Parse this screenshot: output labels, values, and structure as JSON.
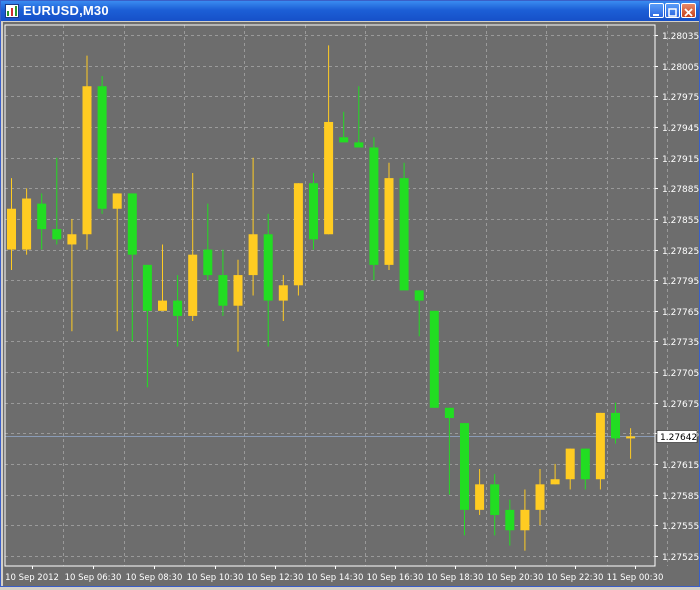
{
  "window": {
    "title": "EURUSD,M30"
  },
  "colors": {
    "background": "#6d6d6d",
    "grid": "#9a9a9a",
    "axis": "#ffffff",
    "bull": "#ffcc22",
    "bear": "#22dd22",
    "price_line": "#8a9bb5"
  },
  "chart_data": {
    "type": "candlestick",
    "title": "EURUSD,M30",
    "ylim": [
      1.2751,
      1.2805
    ],
    "y_ticks": [
      "1.28035",
      "1.28005",
      "1.27975",
      "1.27945",
      "1.27915",
      "1.27885",
      "1.27855",
      "1.27825",
      "1.27795",
      "1.27765",
      "1.27735",
      "1.27705",
      "1.27675",
      "1.27645",
      "1.27615",
      "1.27585",
      "1.27555",
      "1.27525"
    ],
    "x_ticks": [
      "10 Sep 2012",
      "10 Sep 06:30",
      "10 Sep 08:30",
      "10 Sep 10:30",
      "10 Sep 12:30",
      "10 Sep 14:30",
      "10 Sep 16:30",
      "10 Sep 18:30",
      "10 Sep 20:30",
      "10 Sep 22:30",
      "11 Sep 00:30"
    ],
    "current_price": "1.27642",
    "grid": true,
    "candles": [
      {
        "o": 1.27825,
        "h": 1.27895,
        "l": 1.27805,
        "c": 1.27865
      },
      {
        "o": 1.27825,
        "h": 1.27885,
        "l": 1.2782,
        "c": 1.27875
      },
      {
        "o": 1.2787,
        "h": 1.2788,
        "l": 1.27825,
        "c": 1.27845
      },
      {
        "o": 1.27845,
        "h": 1.27915,
        "l": 1.2783,
        "c": 1.27835
      },
      {
        "o": 1.2783,
        "h": 1.27855,
        "l": 1.27745,
        "c": 1.2784
      },
      {
        "o": 1.2784,
        "h": 1.28015,
        "l": 1.27825,
        "c": 1.27985
      },
      {
        "o": 1.27985,
        "h": 1.27995,
        "l": 1.2786,
        "c": 1.27865
      },
      {
        "o": 1.27865,
        "h": 1.2788,
        "l": 1.27745,
        "c": 1.2788
      },
      {
        "o": 1.2788,
        "h": 1.2788,
        "l": 1.27735,
        "c": 1.2782
      },
      {
        "o": 1.2781,
        "h": 1.2781,
        "l": 1.2769,
        "c": 1.27765
      },
      {
        "o": 1.27765,
        "h": 1.2783,
        "l": 1.27765,
        "c": 1.27775
      },
      {
        "o": 1.27775,
        "h": 1.278,
        "l": 1.2773,
        "c": 1.2776
      },
      {
        "o": 1.2776,
        "h": 1.279,
        "l": 1.27755,
        "c": 1.2782
      },
      {
        "o": 1.27825,
        "h": 1.2787,
        "l": 1.27795,
        "c": 1.278
      },
      {
        "o": 1.278,
        "h": 1.27825,
        "l": 1.2776,
        "c": 1.2777
      },
      {
        "o": 1.2777,
        "h": 1.27815,
        "l": 1.27725,
        "c": 1.278
      },
      {
        "o": 1.278,
        "h": 1.27915,
        "l": 1.2778,
        "c": 1.2784
      },
      {
        "o": 1.2784,
        "h": 1.2786,
        "l": 1.2773,
        "c": 1.27775
      },
      {
        "o": 1.27775,
        "h": 1.278,
        "l": 1.27755,
        "c": 1.2779
      },
      {
        "o": 1.2779,
        "h": 1.2789,
        "l": 1.2778,
        "c": 1.2789
      },
      {
        "o": 1.2789,
        "h": 1.279,
        "l": 1.27825,
        "c": 1.27835
      },
      {
        "o": 1.2784,
        "h": 1.28025,
        "l": 1.2784,
        "c": 1.2795
      },
      {
        "o": 1.27935,
        "h": 1.2796,
        "l": 1.2793,
        "c": 1.2793
      },
      {
        "o": 1.2793,
        "h": 1.27985,
        "l": 1.27925,
        "c": 1.27925
      },
      {
        "o": 1.27925,
        "h": 1.27935,
        "l": 1.27795,
        "c": 1.2781
      },
      {
        "o": 1.2781,
        "h": 1.2791,
        "l": 1.27805,
        "c": 1.27895
      },
      {
        "o": 1.27895,
        "h": 1.2791,
        "l": 1.2779,
        "c": 1.27785
      },
      {
        "o": 1.27785,
        "h": 1.27785,
        "l": 1.2774,
        "c": 1.27775
      },
      {
        "o": 1.27765,
        "h": 1.27765,
        "l": 1.2767,
        "c": 1.2767
      },
      {
        "o": 1.2767,
        "h": 1.2767,
        "l": 1.27585,
        "c": 1.2766
      },
      {
        "o": 1.27655,
        "h": 1.27655,
        "l": 1.27545,
        "c": 1.2757
      },
      {
        "o": 1.2757,
        "h": 1.2761,
        "l": 1.27565,
        "c": 1.27595
      },
      {
        "o": 1.27595,
        "h": 1.27605,
        "l": 1.27545,
        "c": 1.27565
      },
      {
        "o": 1.2757,
        "h": 1.2758,
        "l": 1.27535,
        "c": 1.2755
      },
      {
        "o": 1.2755,
        "h": 1.2759,
        "l": 1.2753,
        "c": 1.2757
      },
      {
        "o": 1.2757,
        "h": 1.2761,
        "l": 1.27555,
        "c": 1.27595
      },
      {
        "o": 1.27595,
        "h": 1.27615,
        "l": 1.27595,
        "c": 1.276
      },
      {
        "o": 1.276,
        "h": 1.2763,
        "l": 1.2759,
        "c": 1.2763
      },
      {
        "o": 1.2763,
        "h": 1.2763,
        "l": 1.2759,
        "c": 1.276
      },
      {
        "o": 1.276,
        "h": 1.27665,
        "l": 1.2759,
        "c": 1.27665
      },
      {
        "o": 1.27665,
        "h": 1.27675,
        "l": 1.27635,
        "c": 1.2764
      },
      {
        "o": 1.2764,
        "h": 1.2765,
        "l": 1.2762,
        "c": 1.27642
      }
    ]
  }
}
